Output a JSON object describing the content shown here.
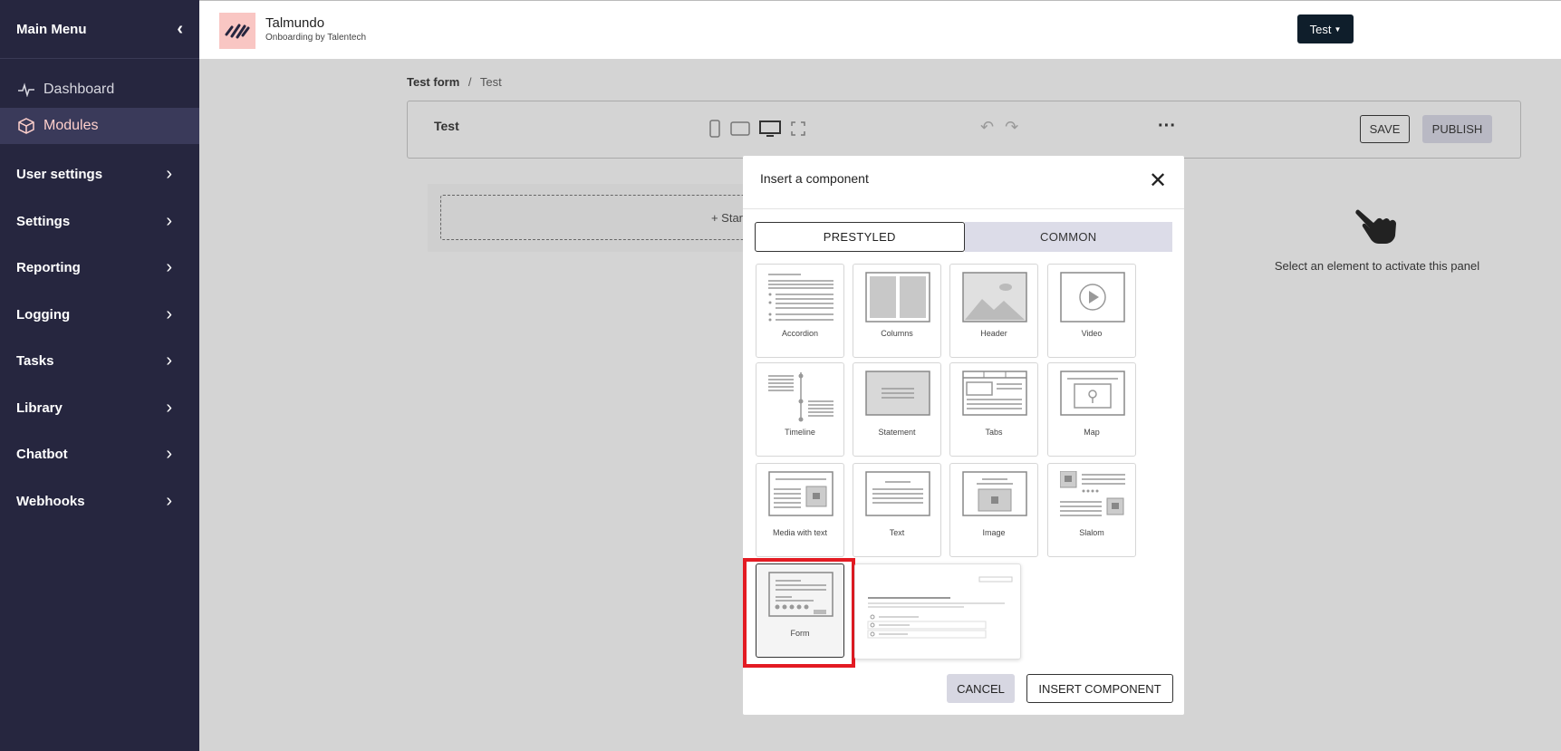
{
  "sidebar": {
    "title": "Main Menu",
    "links": [
      {
        "label": "Dashboard",
        "icon": "activity-icon"
      },
      {
        "label": "Modules",
        "icon": "cube-icon",
        "active": true
      }
    ],
    "items": [
      {
        "label": "User settings"
      },
      {
        "label": "Settings"
      },
      {
        "label": "Reporting"
      },
      {
        "label": "Logging"
      },
      {
        "label": "Tasks"
      },
      {
        "label": "Library"
      },
      {
        "label": "Chatbot"
      },
      {
        "label": "Webhooks"
      }
    ]
  },
  "header": {
    "brand_name": "Talmundo",
    "brand_sub": "Onboarding by Talentech",
    "env_button": "Test"
  },
  "breadcrumb": {
    "parent": "Test form",
    "separator": "/",
    "current": "Test"
  },
  "editor": {
    "title": "Test",
    "save_label": "SAVE",
    "publish_label": "PUBLISH",
    "start_label": "+ Star"
  },
  "right_panel": {
    "hint": "Select an element to activate this panel"
  },
  "modal": {
    "title": "Insert a component",
    "tabs": [
      {
        "label": "PRESTYLED"
      },
      {
        "label": "COMMON"
      }
    ],
    "components": [
      {
        "label": "Accordion",
        "icon": "accordion-icon"
      },
      {
        "label": "Columns",
        "icon": "columns-icon"
      },
      {
        "label": "Header",
        "icon": "header-image-icon"
      },
      {
        "label": "Video",
        "icon": "video-play-icon"
      },
      {
        "label": "Timeline",
        "icon": "timeline-icon"
      },
      {
        "label": "Statement",
        "icon": "statement-icon"
      },
      {
        "label": "Tabs",
        "icon": "tabs-icon"
      },
      {
        "label": "Map",
        "icon": "map-pin-icon"
      },
      {
        "label": "Media with text",
        "icon": "media-text-icon"
      },
      {
        "label": "Text",
        "icon": "text-icon"
      },
      {
        "label": "Image",
        "icon": "image-icon"
      },
      {
        "label": "Slalom",
        "icon": "slalom-icon"
      },
      {
        "label": "Form",
        "icon": "form-icon",
        "selected": true
      }
    ],
    "cancel_label": "CANCEL",
    "insert_label": "INSERT COMPONENT"
  },
  "colors": {
    "sidebar_bg": "#26263f",
    "accent_pink": "#f9c6c3",
    "highlight_red": "#e31b23",
    "env_button_bg": "#0f1e2b"
  }
}
